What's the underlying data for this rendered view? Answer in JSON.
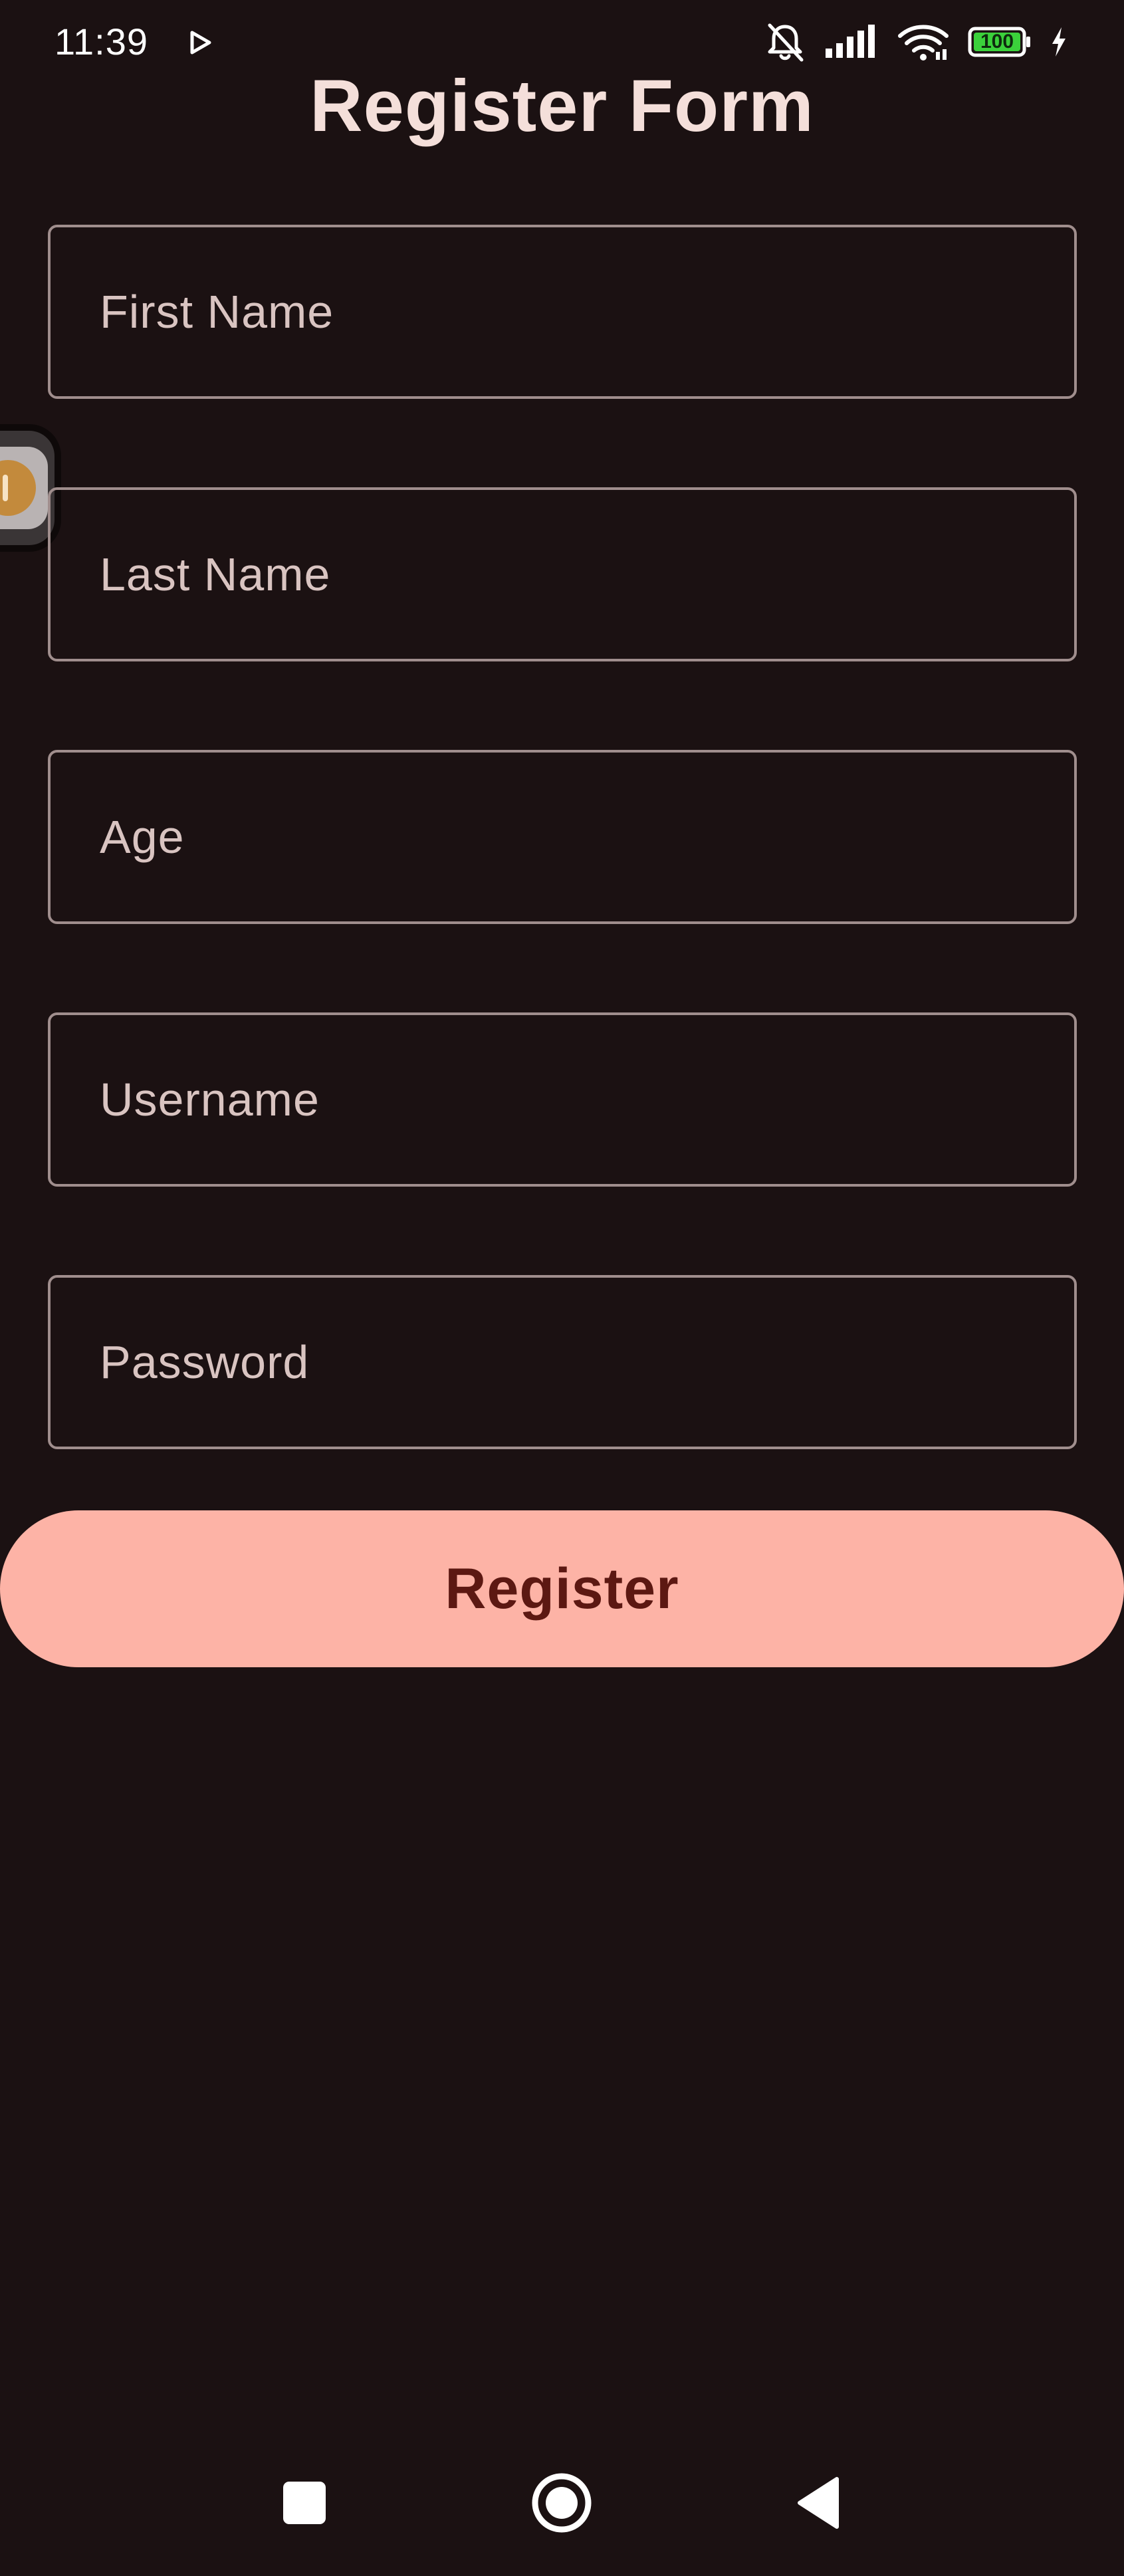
{
  "status_bar": {
    "time": "11:39",
    "battery_level": "100",
    "icons": [
      "play-icon",
      "bell-off-icon",
      "signal-icon",
      "wifi-icon",
      "battery-icon",
      "charging-bolt-icon"
    ]
  },
  "page": {
    "title": "Register Form"
  },
  "form": {
    "fields": [
      {
        "placeholder": "First Name",
        "value": ""
      },
      {
        "placeholder": "Last Name",
        "value": ""
      },
      {
        "placeholder": "Age",
        "value": ""
      },
      {
        "placeholder": "Username",
        "value": ""
      },
      {
        "placeholder": "Password",
        "value": ""
      }
    ],
    "submit_label": "Register"
  },
  "nav_bar": {
    "icons": [
      "recents-square-icon",
      "home-circle-icon",
      "back-triangle-icon"
    ]
  },
  "colors": {
    "background": "#1b1112",
    "title_text": "#f4dfda",
    "field_border": "#a08e8d",
    "placeholder_text": "#d9c4c1",
    "button_bg": "#fdb3a6",
    "button_text": "#5c1812",
    "battery_fill": "#3bd13b"
  }
}
